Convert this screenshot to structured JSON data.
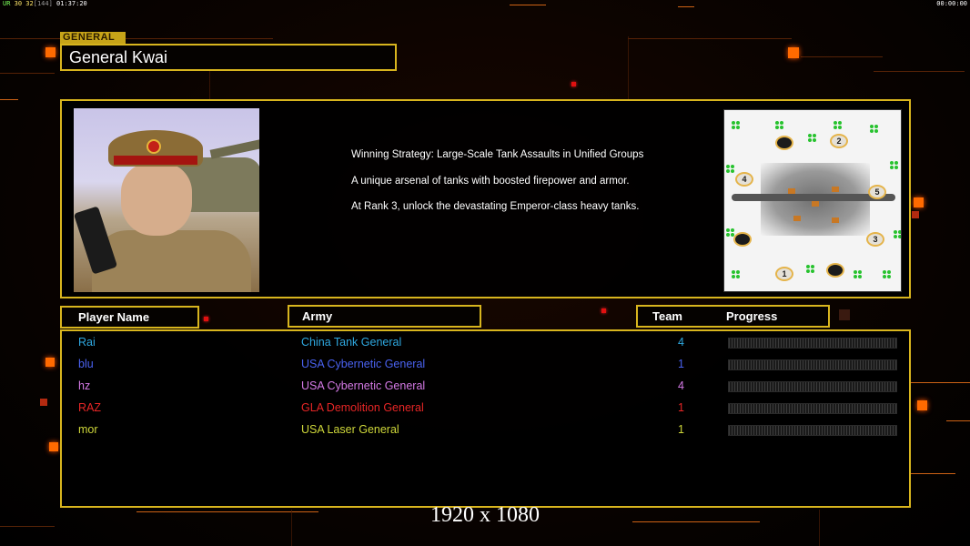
{
  "status_bar": {
    "ur": "UR",
    "fps": "30 32",
    "bracket": "[144]",
    "clock": "01:37:20",
    "right_clock": "00:00:00"
  },
  "general": {
    "label": "GENERAL",
    "title": "General Kwai",
    "portrait_icon": "general-portrait",
    "description": [
      "Winning Strategy: Large-Scale Tank Assaults in Unified Groups",
      "A unique arsenal of tanks with boosted firepower and armor.",
      "At Rank 3, unlock the devastating Emperor-class heavy tanks."
    ]
  },
  "minimap": {
    "start_positions": [
      "1",
      "2",
      "3",
      "4",
      "5"
    ]
  },
  "table": {
    "headers": {
      "player_name": "Player Name",
      "army": "Army",
      "team": "Team",
      "progress": "Progress"
    },
    "rows": [
      {
        "name": "Rai",
        "army": "China Tank General",
        "team": "4",
        "color": "#2fa8e0",
        "progress": 0
      },
      {
        "name": "blu",
        "army": "USA Cybernetic General",
        "team": "1",
        "color": "#4a62f0",
        "progress": 0
      },
      {
        "name": "hz",
        "army": "USA Cybernetic General",
        "team": "4",
        "color": "#d57ae6",
        "progress": 0
      },
      {
        "name": "RAZ",
        "army": "GLA Demolition General",
        "team": "1",
        "color": "#e82626",
        "progress": 0
      },
      {
        "name": "mor",
        "army": "USA Laser General",
        "team": "1",
        "color": "#cfd83a",
        "progress": 0
      }
    ]
  },
  "resolution_caption": "1920 x 1080",
  "colors": {
    "accent": "#d8b51e",
    "glow": "#ff6a00"
  }
}
